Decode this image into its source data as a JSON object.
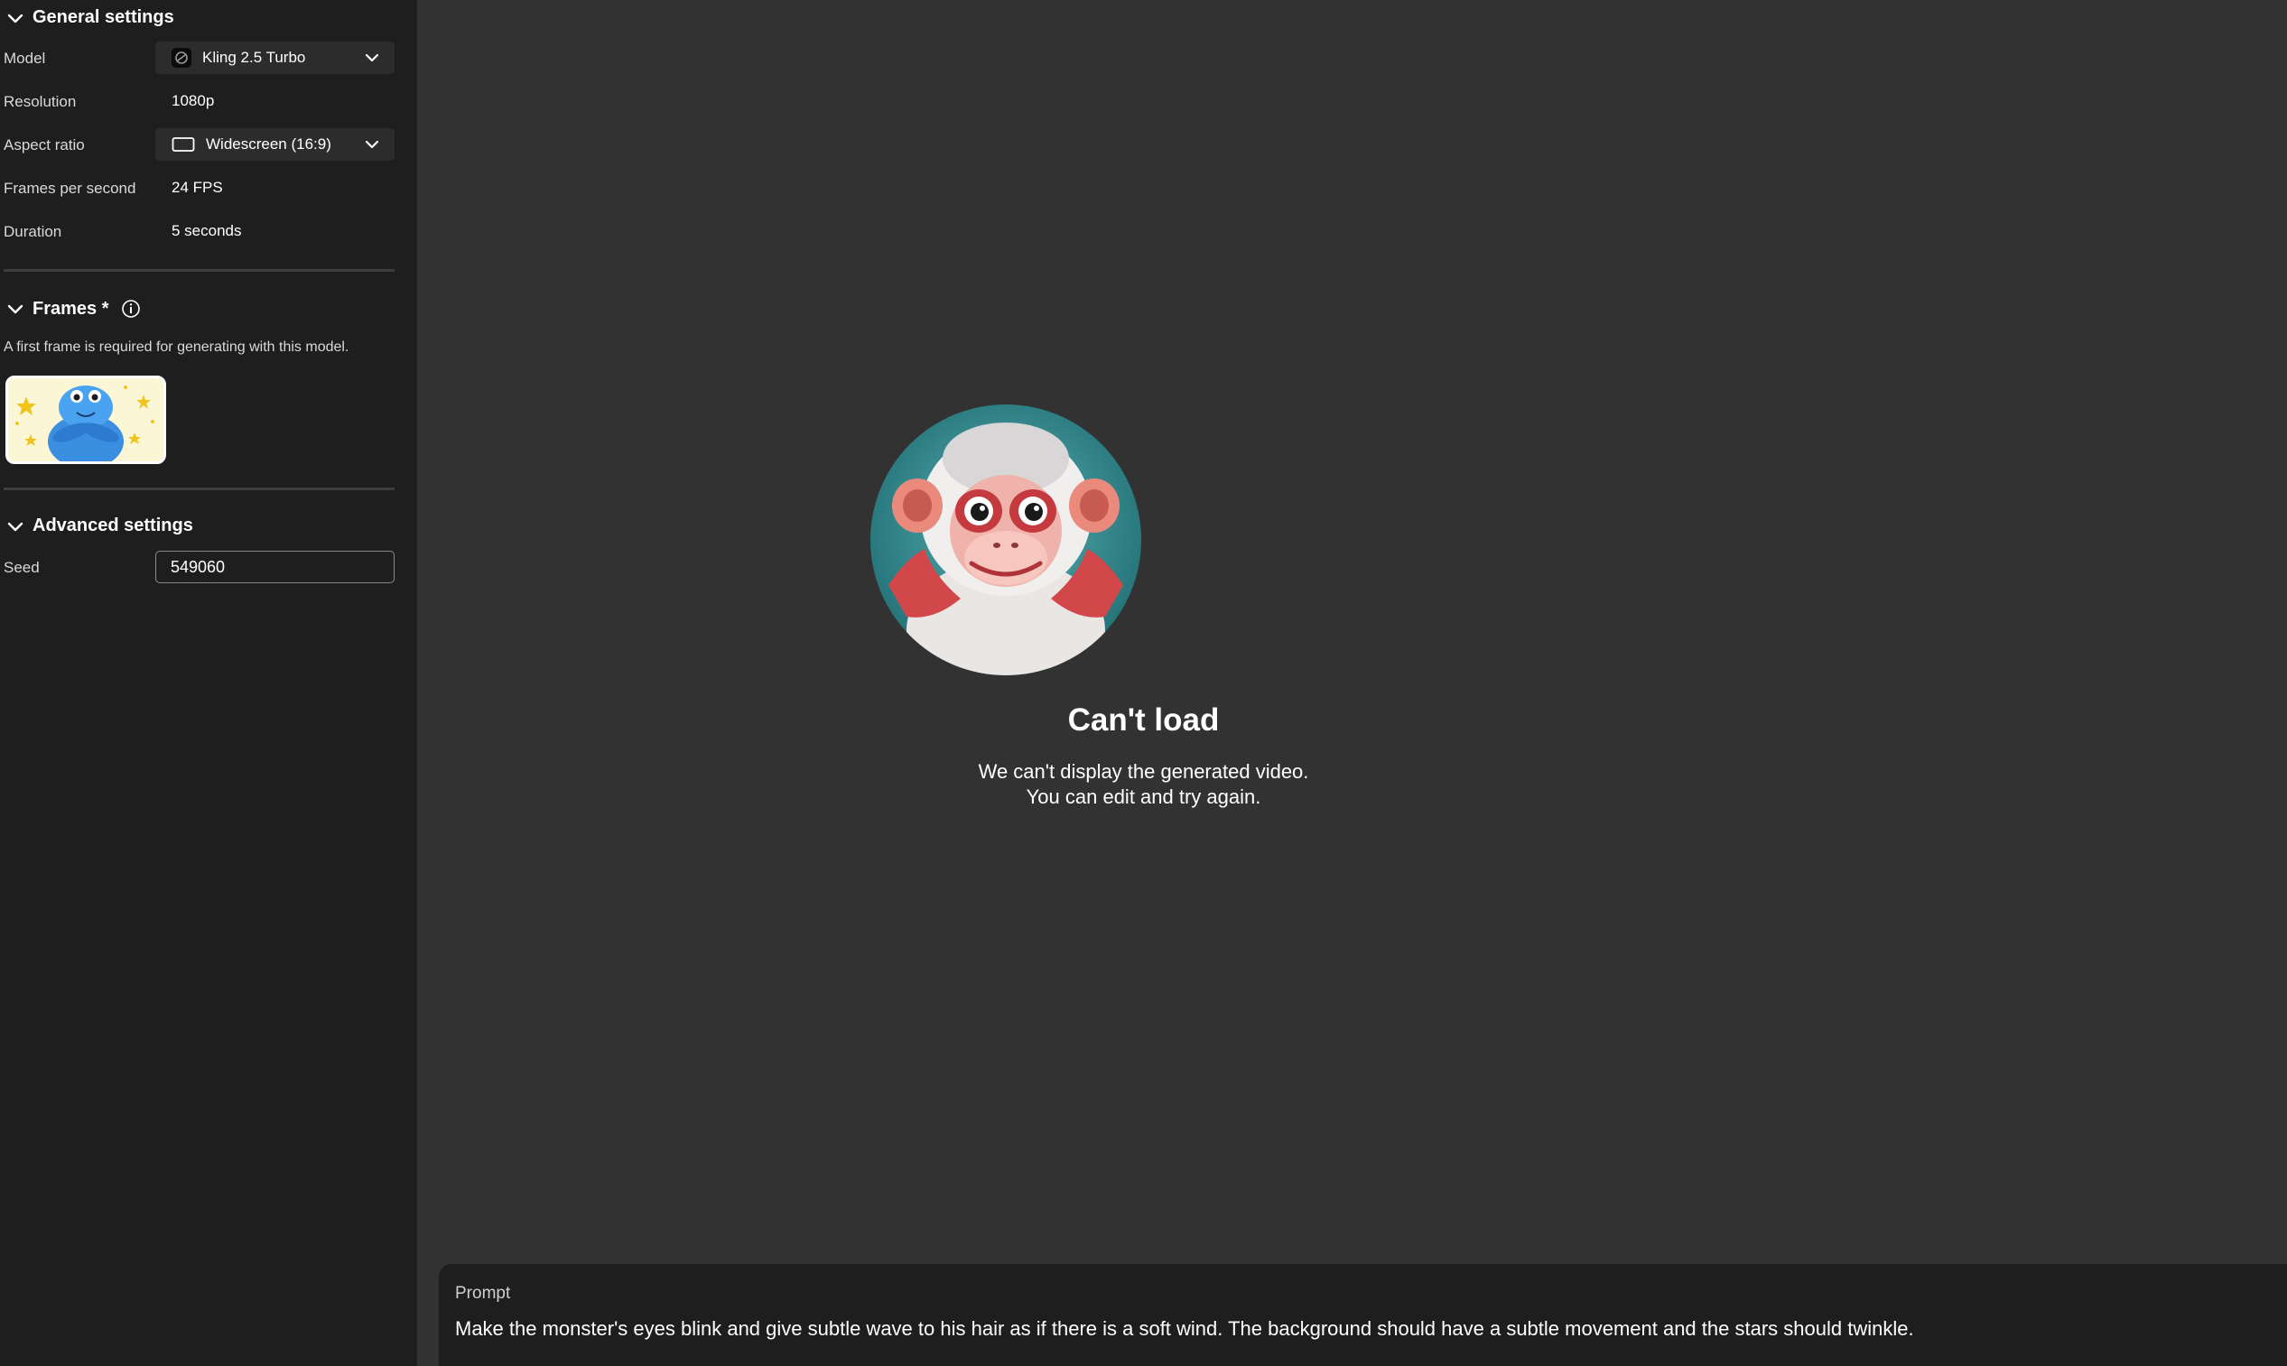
{
  "sidebar": {
    "general": {
      "title": "General settings",
      "model_label": "Model",
      "model_value": "Kling 2.5 Turbo",
      "resolution_label": "Resolution",
      "resolution_value": "1080p",
      "aspect_label": "Aspect ratio",
      "aspect_value": "Widescreen (16:9)",
      "fps_label": "Frames per second",
      "fps_value": "24 FPS",
      "duration_label": "Duration",
      "duration_value": "5 seconds"
    },
    "frames": {
      "title": "Frames *",
      "note": "A first frame is required for generating with this model."
    },
    "advanced": {
      "title": "Advanced settings",
      "seed_label": "Seed",
      "seed_value": "549060"
    }
  },
  "main": {
    "error_title": "Can't load",
    "error_line1": "We can't display the generated video.",
    "error_line2": "You can edit and try again."
  },
  "prompt": {
    "label": "Prompt",
    "text": "Make the monster's eyes blink and give subtle wave to his hair as if there is a soft wind. The background should have a subtle movement and the stars should twinkle."
  },
  "colors": {
    "sidebar_bg": "#1e1e1e",
    "main_bg": "#323232",
    "control_bg": "#2c2c2c"
  }
}
